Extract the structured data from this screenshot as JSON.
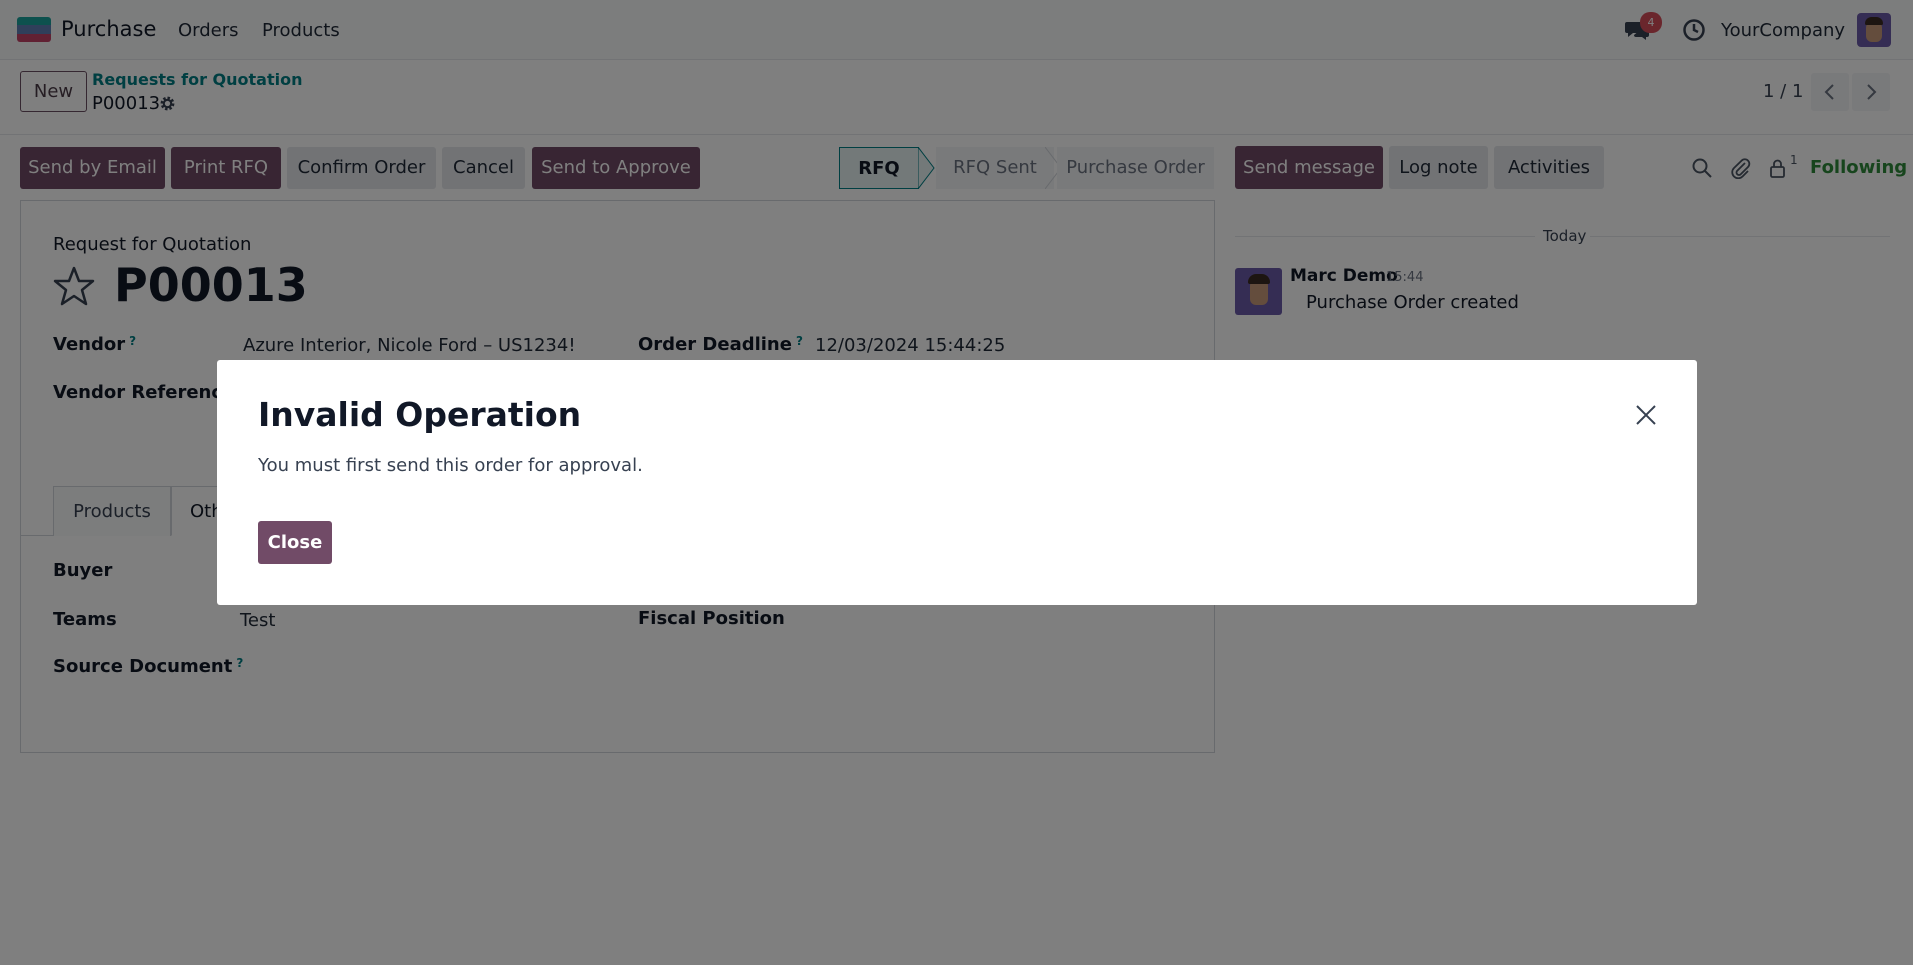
{
  "topbar": {
    "app_name": "Purchase",
    "menu": [
      "Orders",
      "Products"
    ],
    "message_count": "4",
    "company": "YourCompany",
    "icons": [
      "apps-icon",
      "chat-icon",
      "clock-icon",
      "avatar"
    ]
  },
  "controlbar": {
    "new_label": "New",
    "breadcrumb": "Requests for Quotation",
    "record": "P00013",
    "pager": "1 / 1"
  },
  "actions": {
    "send_email": "Send by Email",
    "print_rfq": "Print RFQ",
    "confirm_order": "Confirm Order",
    "cancel": "Cancel",
    "send_approve": "Send to Approve"
  },
  "status": {
    "stages": [
      "RFQ",
      "RFQ Sent",
      "Purchase Order"
    ],
    "active": "RFQ"
  },
  "chatter_bar": {
    "send_message": "Send message",
    "log_note": "Log note",
    "activities": "Activities",
    "followers_count": "1",
    "following": "Following"
  },
  "form": {
    "doc_type": "Request for Quotation",
    "name": "P00013",
    "vendor_label": "Vendor",
    "vendor_value": "Azure Interior, Nicole Ford – US1234!",
    "deadline_label": "Order Deadline",
    "deadline_value": "12/03/2024 15:44:25",
    "vendor_ref_label": "Vendor Reference",
    "help_mark": "?",
    "tabs": [
      "Products",
      "Oth"
    ],
    "buyer_label": "Buyer",
    "teams_label": "Teams",
    "teams_value": "Test",
    "fiscal_label": "Fiscal Position",
    "source_label": "Source Document"
  },
  "chatter": {
    "day": "Today",
    "author": "Marc Demo",
    "time": "15:44",
    "body": "Purchase Order created"
  },
  "dialog": {
    "title": "Invalid Operation",
    "message": "You must first send this order for approval.",
    "close_label": "Close"
  },
  "colors": {
    "primary": "#714b67",
    "accent": "#017e84",
    "following": "#2e8b3a",
    "badge": "#d44c59"
  }
}
